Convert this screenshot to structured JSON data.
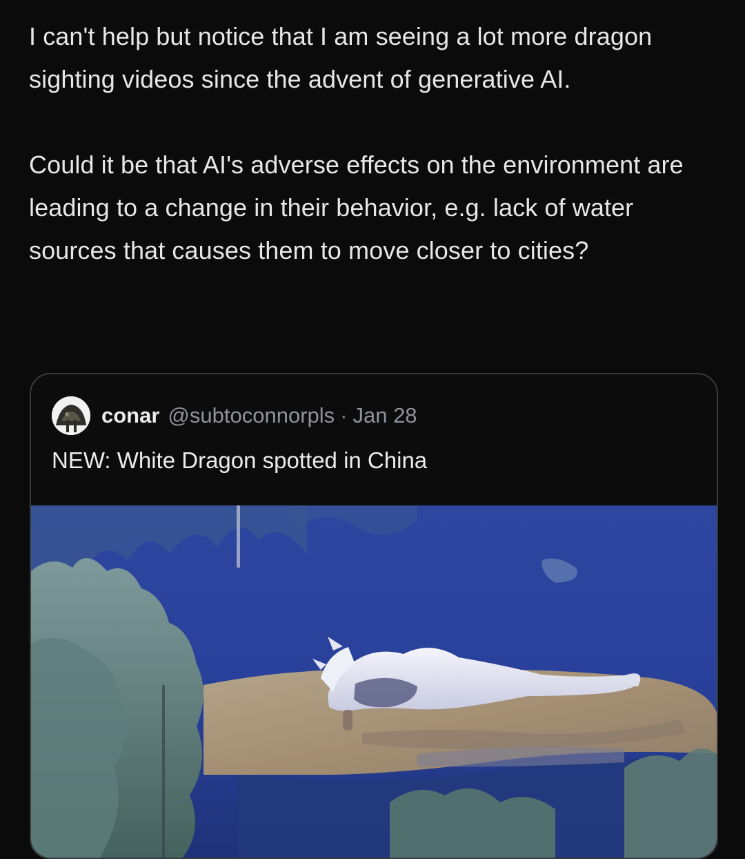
{
  "post": {
    "paragraph_1": "I can't help but notice that I am seeing a lot more dragon sighting videos since the advent of generative AI.",
    "paragraph_2": "Could it be that AI's adverse effects on the environment are leading to a change in their behavior, e.g. lack of water sources that causes them to move closer to cities?"
  },
  "quoted_post": {
    "author_name": "conar",
    "author_handle": "@subtoconnorpls",
    "separator": "·",
    "date": "Jan 28",
    "text": "NEW: White Dragon spotted in China",
    "avatar_icon": "avatar-photo",
    "media_icon": "video-thumbnail"
  },
  "colors": {
    "background": "#0b0b0c",
    "text": "#e7e7e8",
    "muted": "#8f9398",
    "card_border": "#3a3b3d"
  }
}
